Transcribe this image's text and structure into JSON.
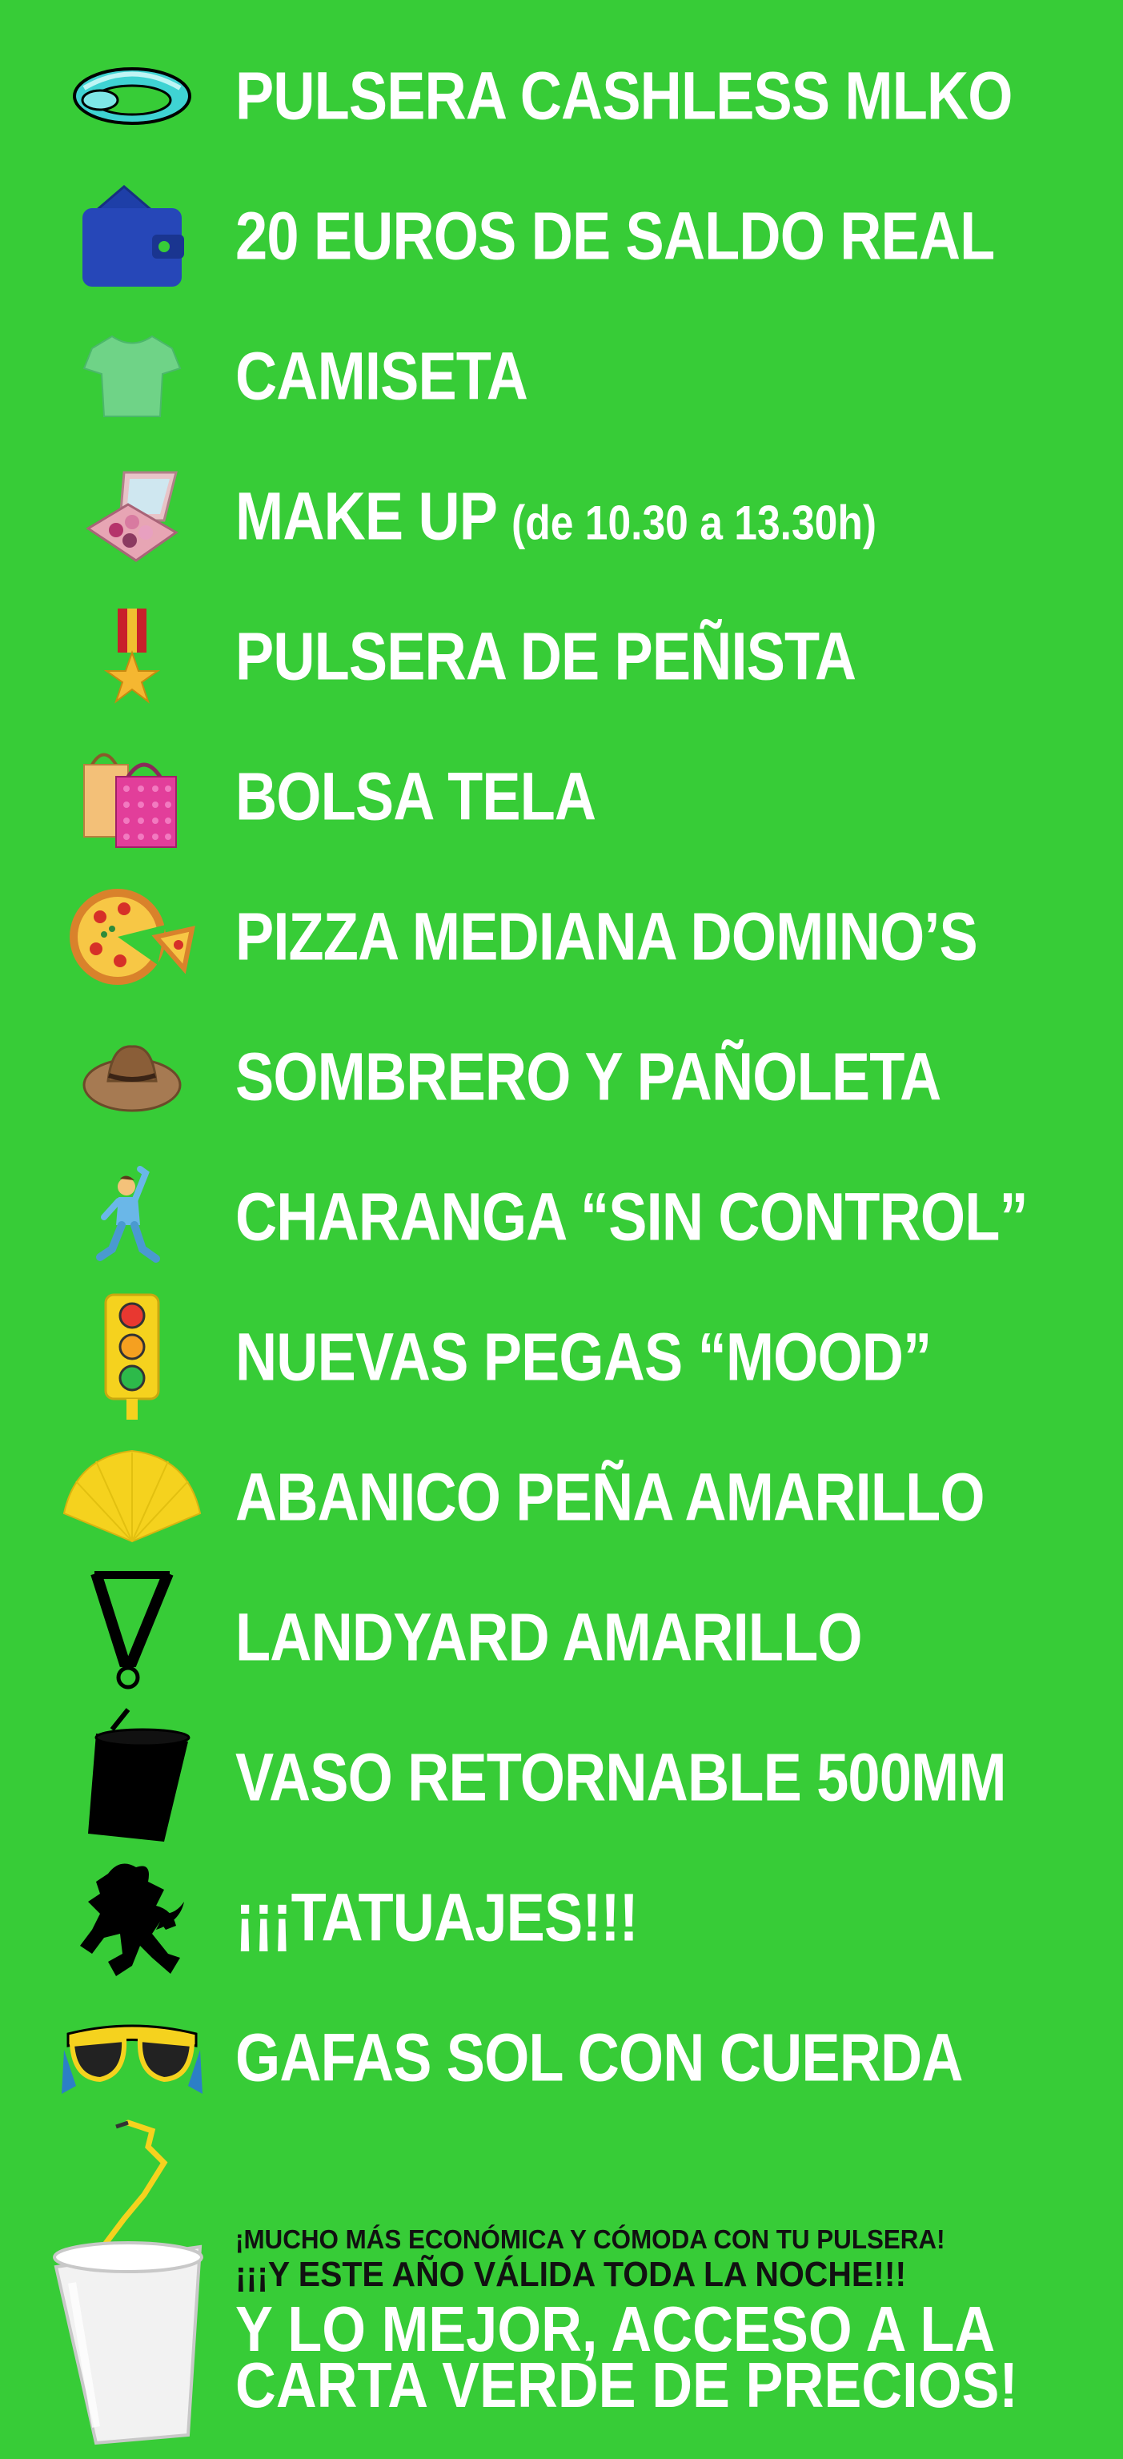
{
  "items": [
    {
      "icon": "bracelet-icon",
      "label": "PULSERA CASHLESS MLKO"
    },
    {
      "icon": "wallet-icon",
      "label": "20 EUROS DE SALDO REAL"
    },
    {
      "icon": "tshirt-icon",
      "label": "CAMISETA"
    },
    {
      "icon": "makeup-palette-icon",
      "label": "MAKE UP",
      "sub": "(de 10.30 a 13.30h)"
    },
    {
      "icon": "medal-icon",
      "label": "PULSERA DE PEÑISTA"
    },
    {
      "icon": "shopping-bags-icon",
      "label": "BOLSA TELA"
    },
    {
      "icon": "pizza-icon",
      "label": "PIZZA MEDIANA DOMINO’S"
    },
    {
      "icon": "hat-icon",
      "label": "SOMBRERO Y PAÑOLETA"
    },
    {
      "icon": "dancer-icon",
      "label": "CHARANGA “SIN CONTROL”"
    },
    {
      "icon": "traffic-light-icon",
      "label": "NUEVAS PEGAS “MOOD”"
    },
    {
      "icon": "fan-icon",
      "label": "ABANICO PEÑA AMARILLO"
    },
    {
      "icon": "lanyard-icon",
      "label": "LANDYARD AMARILLO"
    },
    {
      "icon": "cup-icon",
      "label": "VASO RETORNABLE 500MM"
    },
    {
      "icon": "lion-icon",
      "label": "¡¡¡TATUAJES!!!"
    },
    {
      "icon": "sunglasses-icon",
      "label": "GAFAS SOL CON CUERDA"
    }
  ],
  "footer": {
    "line1": "¡MUCHO MÁS ECONÓMICA Y CÓMODA CON TU PULSERA!",
    "line2": "¡¡¡Y ESTE AÑO VÁLIDA TODA LA NOCHE!!!",
    "line3a": "Y LO MEJOR, ACCESO A LA",
    "line3b": "CARTA VERDE DE PRECIOS!",
    "icon": "plastic-cup-with-strap-icon"
  }
}
